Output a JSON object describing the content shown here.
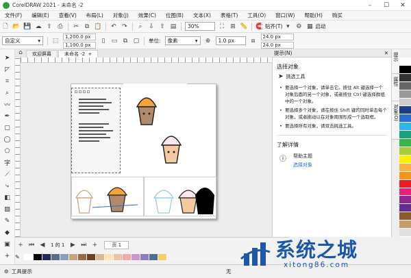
{
  "window": {
    "title": "CorelDRAW 2021 - 未命名 -2"
  },
  "menu": [
    "文件(F)",
    "编辑(E)",
    "查看(V)",
    "布局(L)",
    "对象(J)",
    "效果(C)",
    "位图(B)",
    "文本(X)",
    "表格(T)",
    "工具(O)",
    "窗口(W)",
    "帮助(H)",
    "购买"
  ],
  "toolbar": {
    "zoom": "30%",
    "snap_label": "贴齐(T)",
    "launch_label": "启动"
  },
  "propbar": {
    "page_preset": "自定义",
    "width": "1,200.0 px",
    "height": "1,100.0 px",
    "unit_label": "单位:",
    "unit": "像素",
    "nudge": "1.0 px",
    "dup_x": "24.0 px",
    "dup_y": "24.0 px"
  },
  "tabs": [
    "欢迎屏幕",
    "未命名 -2"
  ],
  "docker": {
    "title": "提示(N)",
    "heading": "选择对象",
    "tool": "挑选工具",
    "tips": [
      "要选择一个对象，请单击它。按住 Alt 键选择一个对象后面的另一个对象，或者按住 Ctrl 键选择群组中的一个对象。",
      "要选择多个对象，请在按住 Shift 键的同时单击每个对象，或者拖动以在对象周围形成一个选取框。",
      "要选择所有对象，请双击挑选工具。"
    ],
    "more": "了解详情",
    "help_title": "帮助主题",
    "help_link": "选择对象"
  },
  "sidetabs": [
    "提示",
    "属性",
    "对象(O)"
  ],
  "pages": {
    "count_text": "1 的 1",
    "tab": "页 1"
  },
  "status": {
    "text": "工具提示",
    "extra": "无"
  },
  "watermark": {
    "text": "系统之城",
    "url": "xitong86.com"
  },
  "palette_colors": [
    "#ffffff",
    "#000000",
    "#333333",
    "#666666",
    "#999999",
    "#cccccc",
    "#1f3b8c",
    "#2a6bd6",
    "#2fb3e8",
    "#16a37b",
    "#3ab54a",
    "#a5cf3a",
    "#fff000",
    "#fbb040",
    "#f7941d",
    "#ec1c24",
    "#ed1e79",
    "#92278f",
    "#662d91",
    "#8b5a2b",
    "#c69c6d",
    "#e0e0e0"
  ],
  "strip_colors": [
    "#ffffff",
    "#000000",
    "#1e2a5c",
    "#5b6b8c",
    "#8aa0b8",
    "#c4a484",
    "#9a6a47",
    "#6b4226",
    "#d7b899",
    "#ffe5b4",
    "#e8c5a5",
    "#f7a8a8",
    "#c49bd0",
    "#8e7cc3",
    "#4f6d8f",
    "#f2d16b"
  ]
}
